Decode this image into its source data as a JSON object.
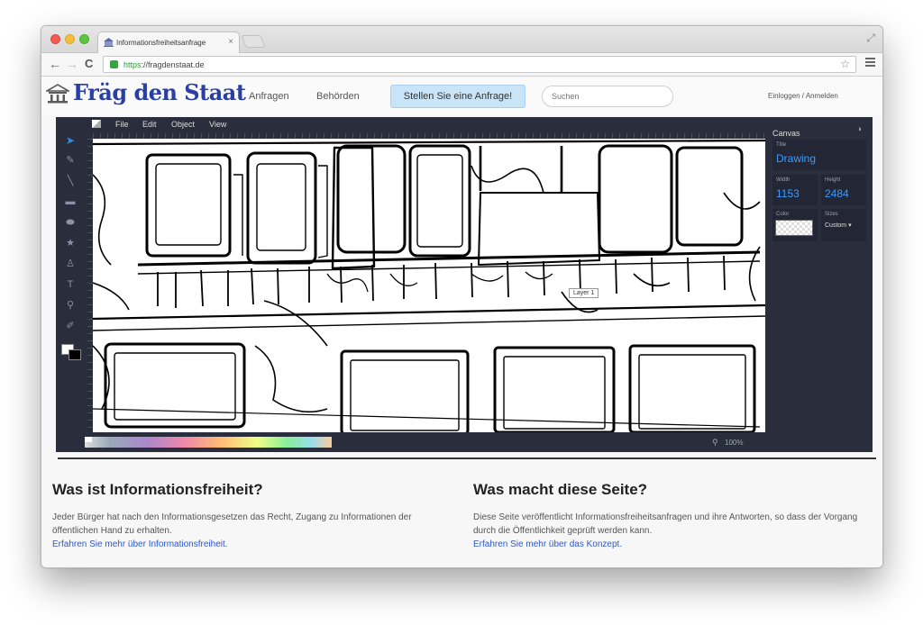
{
  "browser": {
    "tab_title": "Informationsfreiheitsanfrage",
    "tab_close": "×",
    "url_scheme": "https",
    "url_rest": "://fragdenstaat.de"
  },
  "site": {
    "logo_text": "Fräg den Staat",
    "nav": {
      "anfragen": "Anfragen",
      "behoerden": "Behörden"
    },
    "request_button": "Stellen Sie eine Anfrage!",
    "search_placeholder": "Suchen",
    "login": "Einloggen / Anmelden"
  },
  "editor": {
    "menu": {
      "file": "File",
      "edit": "Edit",
      "object": "Object",
      "view": "View"
    },
    "layer_tooltip": "Layer 1",
    "zoom": "100%",
    "panel": {
      "title": "Canvas",
      "title_label": "Title",
      "title_value": "Drawing",
      "width_label": "Width",
      "width_value": "1153",
      "height_label": "Height",
      "height_value": "2484",
      "color_label": "Color",
      "sizes_label": "Sizes",
      "sizes_value": "Custom"
    }
  },
  "content": {
    "left": {
      "heading": "Was ist Informationsfreiheit?",
      "text": "Jeder Bürger hat nach den Informationsgesetzen das Recht, Zugang zu Informationen der öffentlichen Hand zu erhalten.",
      "link": "Erfahren Sie mehr über Informationsfreiheit."
    },
    "right": {
      "heading": "Was macht diese Seite?",
      "text": "Diese Seite veröffentlicht Informationsfreiheitsanfragen und ihre Antworten, so dass der Vorgang durch die Öffentlichkeit geprüft werden kann.",
      "link": "Erfahren Sie mehr über das Konzept."
    }
  },
  "colors": {
    "logo_blue": "#2a3fa6",
    "editor_bg": "#2a2e3c",
    "accent_blue": "#3b9bff",
    "link_blue": "#2f58c9",
    "request_button_bg": "#c9e3f7"
  }
}
